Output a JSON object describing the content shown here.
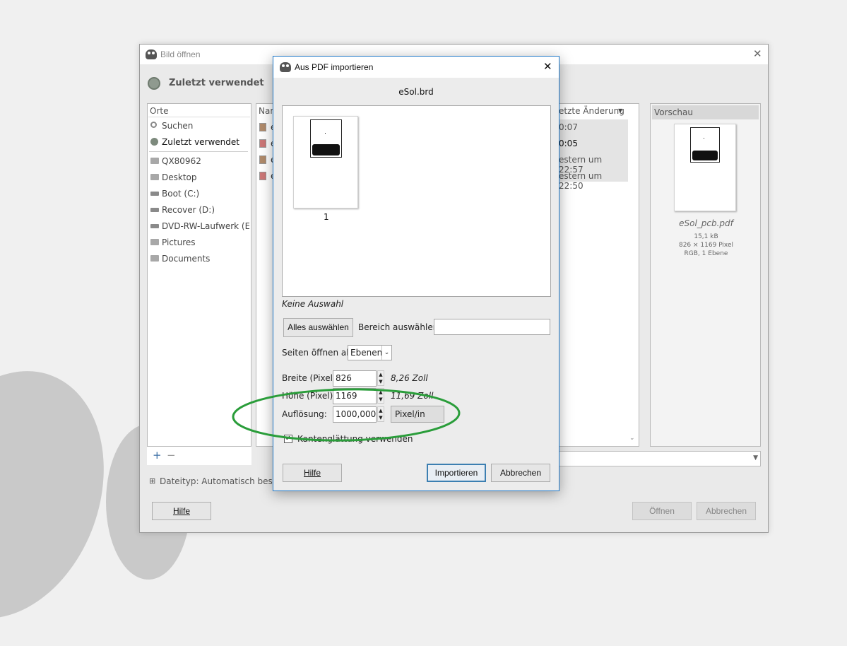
{
  "background_window": {
    "title": "Bild öffnen",
    "section_title": "Zuletzt verwendet",
    "places_header": "Orte",
    "places": [
      {
        "label": "Suchen",
        "icon": "search-icon"
      },
      {
        "label": "Zuletzt verwendet",
        "icon": "recent-icon"
      },
      {
        "label": "QX80962",
        "icon": "folder-icon"
      },
      {
        "label": "Desktop",
        "icon": "folder-icon"
      },
      {
        "label": "Boot (C:)",
        "icon": "drive-icon"
      },
      {
        "label": "Recover (D:)",
        "icon": "drive-icon"
      },
      {
        "label": "DVD-RW-Laufwerk (E...",
        "icon": "dvd-icon"
      },
      {
        "label": "Pictures",
        "icon": "folder-icon"
      },
      {
        "label": "Documents",
        "icon": "folder-icon"
      }
    ],
    "file_list": {
      "name_header": "Nam",
      "modified_header": "etzte Änderung",
      "rows": [
        {
          "name": "e",
          "modified": "0:07"
        },
        {
          "name": "e",
          "modified": "0:05"
        },
        {
          "name": "e",
          "modified": "estern um 22:57"
        },
        {
          "name": "e",
          "modified": "estern um 22:50"
        }
      ]
    },
    "preview": {
      "header": "Vorschau",
      "filename": "eSol_pcb.pdf",
      "size": "15,1 kB",
      "dimensions": "826 × 1169 Pixel",
      "info": "RGB, 1 Ebene"
    },
    "add_label": "+",
    "remove_label": "−",
    "filetype_expander": "⊞",
    "filetype_label": "Dateityp: Automatisch bestimr",
    "buttons": {
      "help": "Hilfe",
      "open": "Öffnen",
      "cancel": "Abbrechen"
    }
  },
  "dialog": {
    "title": "Aus PDF importieren",
    "document_name": "eSol.brd",
    "page_number": "1",
    "selection_status": "Keine Auswahl",
    "select_all": "Alles auswählen",
    "range_label": "Bereich auswählen:",
    "range_value": "",
    "open_pages_as_label": "Seiten öffnen als",
    "open_pages_as_value": "Ebenen",
    "width_label": "Breite (Pixel):",
    "width_value": "826",
    "width_inches": "8,26 Zoll",
    "height_label": "Höhe (Pixel):",
    "height_value": "1169",
    "height_inches": "11,69 Zoll",
    "resolution_label": "Auflösung:",
    "resolution_value": "1000,000",
    "resolution_unit": "Pixel/in",
    "antialias_label": "Kantenglättung verwenden",
    "antialias_checked": true,
    "buttons": {
      "help": "Hilfe",
      "import": "Importieren",
      "cancel": "Abbrechen"
    }
  },
  "colors": {
    "accent": "#1f78c8",
    "annotation": "#2a9d3a"
  }
}
